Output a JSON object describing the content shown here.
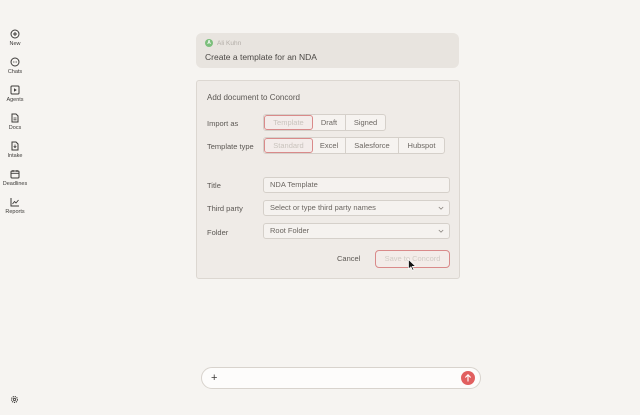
{
  "sidebar": {
    "items": [
      {
        "label": "New",
        "icon": "plus-circle-icon"
      },
      {
        "label": "Chats",
        "icon": "chat-bubble-icon"
      },
      {
        "label": "Agents",
        "icon": "play-square-icon"
      },
      {
        "label": "Docs",
        "icon": "document-icon"
      },
      {
        "label": "Intake",
        "icon": "intake-doc-icon"
      },
      {
        "label": "Deadlines",
        "icon": "calendar-icon"
      },
      {
        "label": "Reports",
        "icon": "line-chart-icon"
      }
    ],
    "settings_icon": "gear-icon"
  },
  "user_message": {
    "avatar_letter": "A",
    "user_name": "Ali Kuhn",
    "text": "Create a template for an NDA"
  },
  "form": {
    "title": "Add document to Concord",
    "import_as": {
      "label": "Import as",
      "options": [
        "Template",
        "Draft",
        "Signed"
      ],
      "selected": "Template"
    },
    "template_type": {
      "label": "Template type",
      "options": [
        "Standard",
        "Excel",
        "Salesforce",
        "Hubspot"
      ],
      "selected": "Standard"
    },
    "title_field": {
      "label": "Title",
      "value": "NDA Template"
    },
    "third_party": {
      "label": "Third party",
      "placeholder": "Select or type third party names"
    },
    "folder": {
      "label": "Folder",
      "value": "Root Folder"
    },
    "cancel_label": "Cancel",
    "save_label": "Save to Concord"
  },
  "composer": {
    "plus": "+",
    "send_icon": "arrow-up-icon",
    "accent": "#e15f5f"
  },
  "colors": {
    "background": "#f6f4f1",
    "selected_border": "#d98a8a"
  }
}
